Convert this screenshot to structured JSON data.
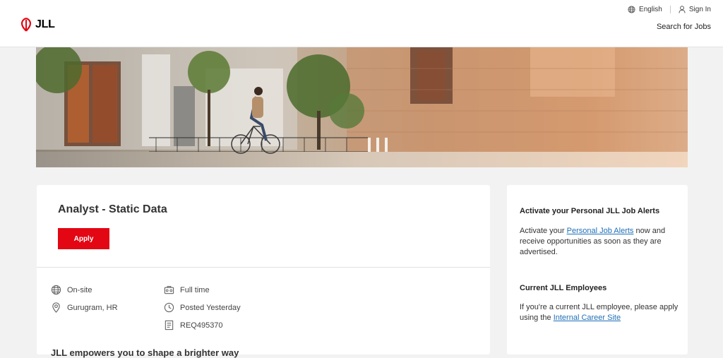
{
  "header": {
    "logo_text": "JLL",
    "language_label": "English",
    "sign_in_label": "Sign In",
    "search_jobs_label": "Search for Jobs"
  },
  "job": {
    "title": "Analyst - Static Data",
    "apply_label": "Apply",
    "work_mode": "On-site",
    "location": "Gurugram, HR",
    "employment_type": "Full time",
    "posted": "Posted Yesterday",
    "requisition_id": "REQ495370",
    "cutoff_heading": "JLL empowers you to shape a brighter way"
  },
  "sidebar": {
    "alerts_heading": "Activate your Personal JLL Job Alerts",
    "alerts_text_before": "Activate your ",
    "alerts_link": "Personal Job Alerts",
    "alerts_text_after": " now and receive opportunities as soon as they are advertised.",
    "employees_heading": "Current JLL Employees",
    "employees_text_before": "If you're a current JLL employee, please apply using the ",
    "employees_link": "Internal Career Site"
  },
  "colors": {
    "brand_red": "#e30613",
    "link_blue": "#1f6fb7",
    "page_bg": "#f2f2f2"
  },
  "icons": {
    "logo": "jll-swirl-logo",
    "language": "globe-icon",
    "account": "user-icon",
    "work_mode": "globe-icon",
    "location": "map-pin-icon",
    "employment_type": "briefcase-icon",
    "posted": "clock-icon",
    "requisition": "document-icon"
  }
}
